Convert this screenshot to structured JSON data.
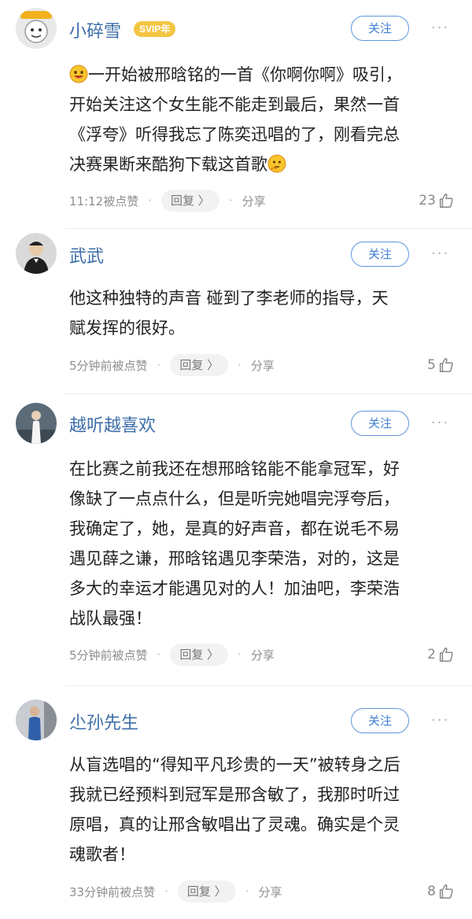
{
  "comments": [
    {
      "username": "小碎雪",
      "badge": "SVIP年",
      "follow_label": "关注",
      "more_label": "···",
      "lines": [
        "一开始被邢晗铭的一首《你啊你啊》吸引，",
        "开始关注这个女生能不能走到最后，果然一首",
        "《浮夸》听得我忘了陈奕迅唱的了，刚看完总",
        "决赛果断来酷狗下载这首歌"
      ],
      "time_label": "11:12被点赞",
      "reply_label": "回复 〉",
      "share_label": "分享",
      "likes": "23"
    },
    {
      "username": "武武",
      "follow_label": "关注",
      "more_label": "···",
      "lines": [
        "他这种独特的声音 碰到了李老师的指导，天",
        "赋发挥的很好。"
      ],
      "time_label": "5分钟前被点赞",
      "reply_label": "回复 〉",
      "share_label": "分享",
      "likes": "5"
    },
    {
      "username": "越听越喜欢",
      "follow_label": "关注",
      "more_label": "···",
      "lines": [
        "在比赛之前我还在想邢晗铭能不能拿冠军，好",
        "像缺了一点点什么，但是听完她唱完浮夸后，",
        "我确定了，她，是真的好声音，都在说毛不易",
        "遇见薛之谦，邢晗铭遇见李荣浩，对的，这是",
        "多大的幸运才能遇见对的人！加油吧，李荣浩",
        "战队最强！"
      ],
      "time_label": "5分钟前被点赞",
      "reply_label": "回复 〉",
      "share_label": "分享",
      "likes": "2"
    },
    {
      "username": "尐孙先生",
      "follow_label": "关注",
      "more_label": "···",
      "lines": [
        "从盲选唱的“得知平凡珍贵的一天”被转身之后",
        "我就已经预料到冠军是邢含敏了，我那时听过",
        "原唱，真的让邢含敏唱出了灵魂。确实是个灵",
        "魂歌者！"
      ],
      "time_label": "33分钟前被点赞",
      "reply_label": "回复 〉",
      "share_label": "分享",
      "likes": "8"
    }
  ],
  "colors": {
    "username": "#3d6ea8",
    "follow_border": "#5e96dc",
    "svip_badge": "#f4c542",
    "meta_text": "#8e8e8e"
  },
  "icons": [
    "avatar",
    "smile-emoji-icon",
    "thinking-emoji-icon",
    "thumbs-up-icon",
    "more-icon"
  ]
}
